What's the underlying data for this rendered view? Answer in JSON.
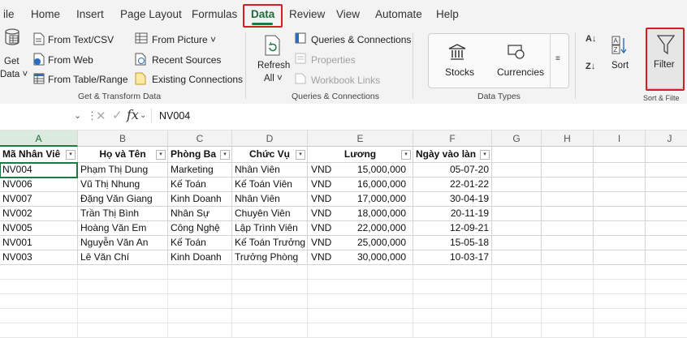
{
  "tabs": [
    "ile",
    "Home",
    "Insert",
    "Page Layout",
    "Formulas",
    "Data",
    "Review",
    "View",
    "Automate",
    "Help"
  ],
  "ribbon": {
    "get_data": {
      "line1": "Get",
      "line2": "Data ˅"
    },
    "from_text_csv": "From Text/CSV",
    "from_web": "From Web",
    "from_table_range": "From Table/Range",
    "from_picture": "From Picture ˅",
    "recent_sources": "Recent Sources",
    "existing_connections": "Existing Connections",
    "get_transform_label": "Get & Transform Data",
    "refresh": {
      "line1": "Refresh",
      "line2": "All ˅"
    },
    "queries_connections": "Queries & Connections",
    "properties": "Properties",
    "workbook_links": "Workbook Links",
    "queries_group_label": "Queries & Connections",
    "stocks": "Stocks",
    "currencies": "Currencies",
    "data_types_label": "Data Types",
    "sort": "Sort",
    "filter": "Filter",
    "sort_filter_label": "Sort & Filte"
  },
  "formula_bar": {
    "fx": "fx",
    "value": "NV004"
  },
  "sheet": {
    "columns": [
      "A",
      "B",
      "C",
      "D",
      "E",
      "F",
      "G",
      "H",
      "I",
      "J"
    ],
    "headers": [
      "Mã Nhân Viê",
      "Họ và Tên",
      "Phòng Ba",
      "Chức Vụ",
      "Lương",
      "Ngày vào làn"
    ],
    "rows": [
      {
        "id": "NV004",
        "name": "Phạm Thị Dung",
        "dept": "Marketing",
        "role": "Nhân Viên",
        "cur": "VND",
        "salary": "15,000,000",
        "date": "05-07-20"
      },
      {
        "id": "NV006",
        "name": "Vũ Thị Nhung",
        "dept": "Kế Toán",
        "role": "Kế Toán Viên",
        "cur": "VND",
        "salary": "16,000,000",
        "date": "22-01-22"
      },
      {
        "id": "NV007",
        "name": "Đặng Văn Giang",
        "dept": "Kinh Doanh",
        "role": "Nhân Viên",
        "cur": "VND",
        "salary": "17,000,000",
        "date": "30-04-19"
      },
      {
        "id": "NV002",
        "name": "Trần Thị Bình",
        "dept": "Nhân Sự",
        "role": "Chuyên Viên",
        "cur": "VND",
        "salary": "18,000,000",
        "date": "20-11-19"
      },
      {
        "id": "NV005",
        "name": "Hoàng Văn Em",
        "dept": "Công Nghệ",
        "role": "Lập Trình Viên",
        "cur": "VND",
        "salary": "22,000,000",
        "date": "12-09-21"
      },
      {
        "id": "NV001",
        "name": "Nguyễn Văn An",
        "dept": "Kế Toán",
        "role": "Kế Toán Trưởng",
        "cur": "VND",
        "salary": "25,000,000",
        "date": "15-05-18"
      },
      {
        "id": "NV003",
        "name": "Lê Văn Chí",
        "dept": "Kinh Doanh",
        "role": "Trưởng Phòng",
        "cur": "VND",
        "salary": "30,000,000",
        "date": "10-03-17"
      }
    ]
  },
  "colors": {
    "accent": "#1e7a43",
    "highlight": "#d01f25"
  }
}
